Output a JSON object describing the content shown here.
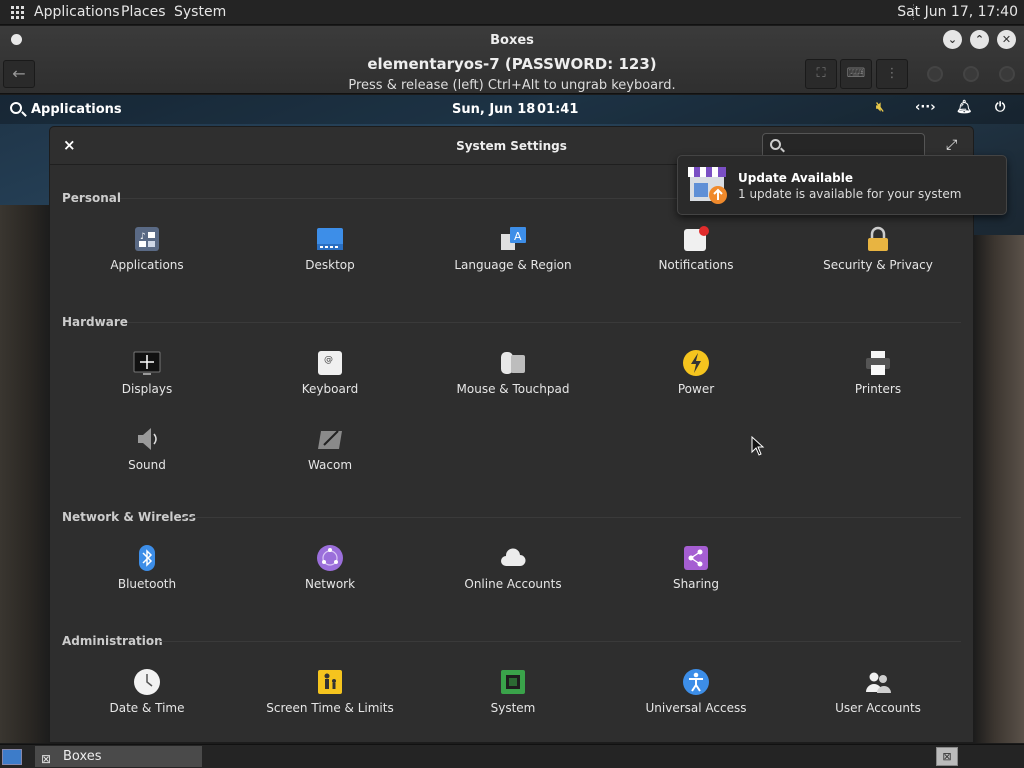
{
  "host_panel": {
    "menu_applications": "Applications",
    "menu_places": "Places",
    "menu_system": "System",
    "clock": "Sat Jun 17, 17:40"
  },
  "boxes": {
    "window_title": "Boxes",
    "vm_name": "elementaryos-7 (PASSWORD: 123)",
    "keyboard_hint": "Press & release (left) Ctrl+Alt to ungrab keyboard."
  },
  "guest_panel": {
    "applications": "Applications",
    "date": "Sun, Jun 18",
    "time": "01:41"
  },
  "settings": {
    "title": "System Settings",
    "search_placeholder": "",
    "sections": {
      "personal": "Personal",
      "hardware": "Hardware",
      "network": "Network & Wireless",
      "administration": "Administration"
    },
    "items": {
      "applications": "Applications",
      "desktop": "Desktop",
      "language": "Language & Region",
      "notifications": "Notifications",
      "security": "Security & Privacy",
      "displays": "Displays",
      "keyboard": "Keyboard",
      "mouse": "Mouse & Touchpad",
      "power": "Power",
      "printers": "Printers",
      "sound": "Sound",
      "wacom": "Wacom",
      "bluetooth": "Bluetooth",
      "network": "Network",
      "online_accounts": "Online Accounts",
      "sharing": "Sharing",
      "datetime": "Date & Time",
      "screentime": "Screen Time & Limits",
      "system": "System",
      "universal": "Universal Access",
      "users": "User Accounts"
    }
  },
  "notification": {
    "title": "Update Available",
    "body": "1 update is available for your system"
  },
  "taskbar": {
    "task_label": "Boxes"
  },
  "colors": {
    "accent_blue": "#3d7cc9",
    "power_yellow": "#f5c41e",
    "sharing_purple": "#a55ed2",
    "network_purple": "#9b6fdb"
  }
}
